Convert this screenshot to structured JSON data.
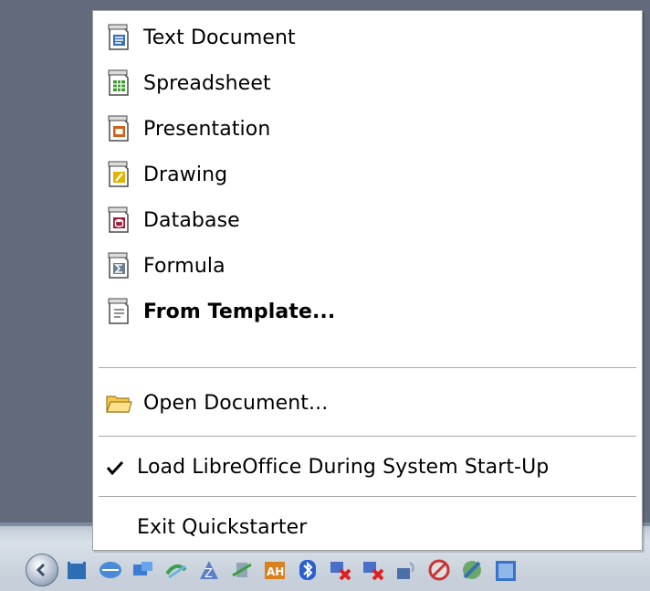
{
  "menu": {
    "items": [
      {
        "label": "Text Document",
        "icon": "text-document-icon"
      },
      {
        "label": "Spreadsheet",
        "icon": "spreadsheet-icon"
      },
      {
        "label": "Presentation",
        "icon": "presentation-icon"
      },
      {
        "label": "Drawing",
        "icon": "drawing-icon"
      },
      {
        "label": "Database",
        "icon": "database-icon"
      },
      {
        "label": "Formula",
        "icon": "formula-icon"
      },
      {
        "label": "From Template...",
        "icon": "template-icon"
      }
    ],
    "open_document": {
      "label": "Open Document...",
      "icon": "folder-icon"
    },
    "load_during_startup": {
      "label": "Load LibreOffice During System Start-Up",
      "checked": true
    },
    "exit": {
      "label": "Exit Quickstarter"
    }
  },
  "colors": {
    "writer": "#3a6fb5",
    "calc": "#3c9a2e",
    "impress": "#d2601a",
    "draw": "#e2b400",
    "base": "#9c1d3a",
    "math": "#6b7d94"
  }
}
